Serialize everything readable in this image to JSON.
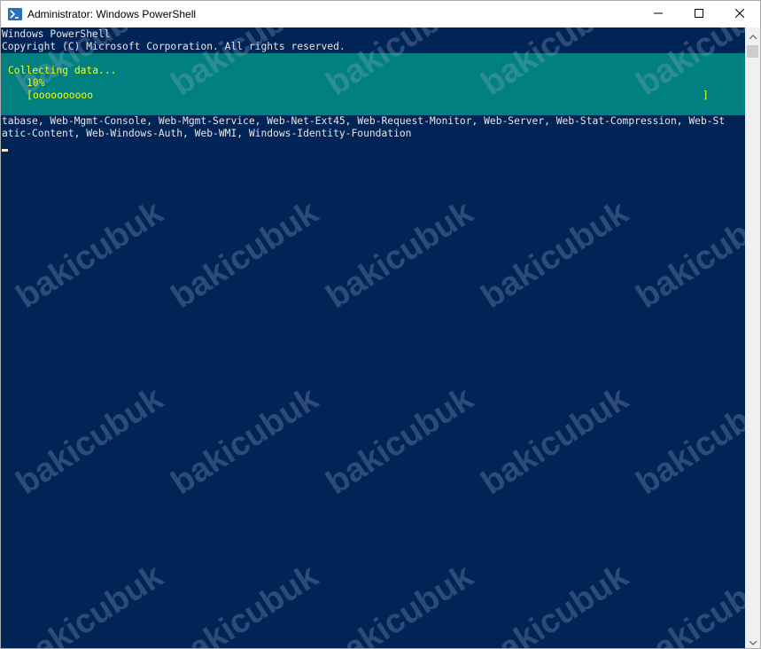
{
  "window": {
    "title": "Administrator: Windows PowerShell"
  },
  "console": {
    "header_line_1": "Windows PowerShell",
    "header_line_2": "Copyright (C) Microsoft Corporation. All rights reserved.",
    "progress_activity": "Collecting data...",
    "progress_percent_text": "10%",
    "progress_bar_open": "[",
    "progress_bar_fill": "oooooooooo",
    "progress_bar_close": "]",
    "progress_fraction": 0.1,
    "output_line_1": "tabase, Web-Mgmt-Console, Web-Mgmt-Service, Web-Net-Ext45, Web-Request-Monitor, Web-Server, Web-Stat-Compression, Web-St",
    "output_line_2": "atic-Content, Web-Windows-Auth, Web-WMI, Windows-Identity-Foundation"
  },
  "watermark": {
    "text": "bakicubuk"
  },
  "colors": {
    "console_bg": "#012456",
    "progress_bg": "#008080",
    "progress_text": "#ffff00",
    "console_text": "#e6e6e6"
  },
  "icons": {
    "app": "powershell-icon",
    "minimize": "minimize-icon",
    "maximize": "maximize-icon",
    "close": "close-icon"
  }
}
